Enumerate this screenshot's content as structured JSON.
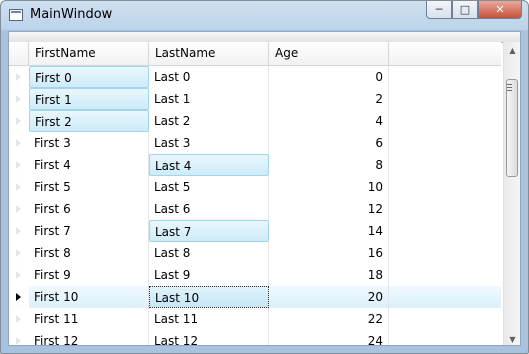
{
  "window": {
    "title": "MainWindow",
    "icon": "window-icon",
    "buttons": {
      "minimize": "minimize-icon",
      "maximize": "maximize-icon",
      "close": "close-icon"
    }
  },
  "grid": {
    "columns": [
      "FirstName",
      "LastName",
      "Age"
    ],
    "rows": [
      {
        "first": "First 0",
        "last": "Last 0",
        "age": "0"
      },
      {
        "first": "First 1",
        "last": "Last 1",
        "age": "2"
      },
      {
        "first": "First 2",
        "last": "Last 2",
        "age": "4"
      },
      {
        "first": "First 3",
        "last": "Last 3",
        "age": "6"
      },
      {
        "first": "First 4",
        "last": "Last 4",
        "age": "8"
      },
      {
        "first": "First 5",
        "last": "Last 5",
        "age": "10"
      },
      {
        "first": "First 6",
        "last": "Last 6",
        "age": "12"
      },
      {
        "first": "First 7",
        "last": "Last 7",
        "age": "14"
      },
      {
        "first": "First 8",
        "last": "Last 8",
        "age": "16"
      },
      {
        "first": "First 9",
        "last": "Last 9",
        "age": "18"
      },
      {
        "first": "First 10",
        "last": "Last 10",
        "age": "20"
      },
      {
        "first": "First 11",
        "last": "Last 11",
        "age": "22"
      },
      {
        "first": "First 12",
        "last": "Last 12",
        "age": "24"
      }
    ],
    "selected_cells": [
      "0:first",
      "1:first",
      "2:first",
      "4:last",
      "7:last"
    ],
    "current_row": 10
  },
  "colors": {
    "selection": "#cdebf8",
    "selection_border": "#9fd5ee"
  }
}
